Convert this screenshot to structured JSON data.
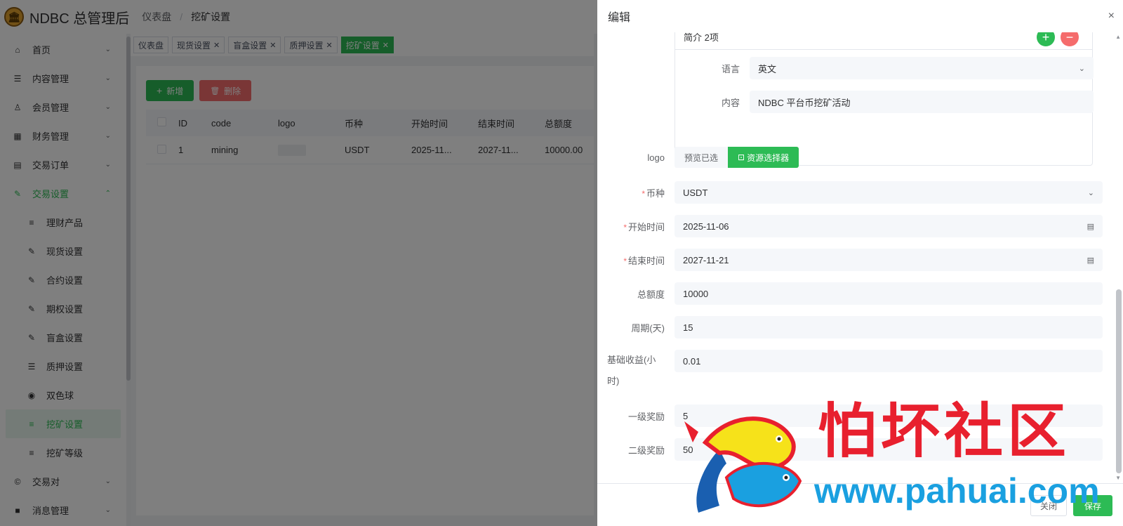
{
  "header": {
    "app_title": "NDBC 总管理后",
    "breadcrumb": [
      "仪表盘",
      "挖矿设置"
    ]
  },
  "sidebar": {
    "items": [
      {
        "label": "首页",
        "icon": "home-icon",
        "glyph": "⌂",
        "arrow": "⌄"
      },
      {
        "label": "内容管理",
        "icon": "list-icon",
        "glyph": "☰",
        "arrow": "⌄"
      },
      {
        "label": "会员管理",
        "icon": "user-icon",
        "glyph": "♙",
        "arrow": "⌄"
      },
      {
        "label": "财务管理",
        "icon": "table-icon",
        "glyph": "▦",
        "arrow": "⌄"
      },
      {
        "label": "交易订单",
        "icon": "order-icon",
        "glyph": "▤",
        "arrow": "⌄"
      },
      {
        "label": "交易设置",
        "icon": "wrench-icon",
        "glyph": "✎",
        "arrow": "⌃"
      }
    ],
    "sub_items": [
      {
        "label": "理财产品",
        "icon": "lines-icon",
        "glyph": "≡"
      },
      {
        "label": "现货设置",
        "icon": "wrench-icon",
        "glyph": "✎"
      },
      {
        "label": "合约设置",
        "icon": "wrench-icon",
        "glyph": "✎"
      },
      {
        "label": "期权设置",
        "icon": "wrench-icon",
        "glyph": "✎"
      },
      {
        "label": "盲盒设置",
        "icon": "wrench-icon",
        "glyph": "✎"
      },
      {
        "label": "质押设置",
        "icon": "list-icon",
        "glyph": "☰"
      },
      {
        "label": "双色球",
        "icon": "target-icon",
        "glyph": "◉"
      },
      {
        "label": "挖矿设置",
        "icon": "lines-icon",
        "glyph": "≡"
      },
      {
        "label": "挖矿等级",
        "icon": "lines-icon",
        "glyph": "≡"
      }
    ],
    "tail_items": [
      {
        "label": "交易对",
        "icon": "copyright-icon",
        "glyph": "©",
        "arrow": "⌄"
      },
      {
        "label": "消息管理",
        "icon": "message-icon",
        "glyph": "■",
        "arrow": "⌄"
      }
    ]
  },
  "tags": [
    {
      "label": "仪表盘",
      "closable": false
    },
    {
      "label": "现货设置",
      "closable": true
    },
    {
      "label": "盲盒设置",
      "closable": true
    },
    {
      "label": "质押设置",
      "closable": true
    },
    {
      "label": "挖矿设置",
      "closable": true
    }
  ],
  "toolbar": {
    "add_label": "新增",
    "add_icon": "+",
    "delete_label": "删除",
    "delete_icon": "🗑"
  },
  "table": {
    "columns": [
      "ID",
      "code",
      "logo",
      "币种",
      "开始时间",
      "结束时间",
      "总额度"
    ],
    "rows": [
      {
        "id": "1",
        "code": "mining",
        "coin": "USDT",
        "start": "2025-11...",
        "end": "2027-11...",
        "total": "10000.00"
      }
    ]
  },
  "drawer": {
    "title": "编辑",
    "close_icon": "×",
    "intro": {
      "head": "简介 2项",
      "add": "+",
      "remove": "−",
      "language_label": "语言",
      "language_value": "英文",
      "content_label": "内容",
      "content_value": "NDBC 平台币挖矿活动"
    },
    "logo_label": "logo",
    "preview_label": "预览已选",
    "resource_label": "资源选择器",
    "fields": {
      "coin": {
        "label": "币种",
        "value": "USDT",
        "required": true
      },
      "start_time": {
        "label": "开始时间",
        "value": "2025-11-06",
        "required": true
      },
      "end_time": {
        "label": "结束时间",
        "value": "2027-11-21",
        "required": true
      },
      "total": {
        "label": "总额度",
        "value": "10000"
      },
      "period": {
        "label": "周期(天)",
        "value": "15"
      },
      "base_income": {
        "label": "基础收益(小时)",
        "value": "0.01"
      },
      "reward_l1": {
        "label": "一级奖励",
        "value": "5"
      },
      "reward_l2": {
        "label": "二级奖励",
        "value": "50"
      }
    },
    "cancel_label": "关闭",
    "save_label": "保存"
  },
  "watermark": {
    "title": "怕坏社区",
    "url": "www.pahuai.com"
  }
}
